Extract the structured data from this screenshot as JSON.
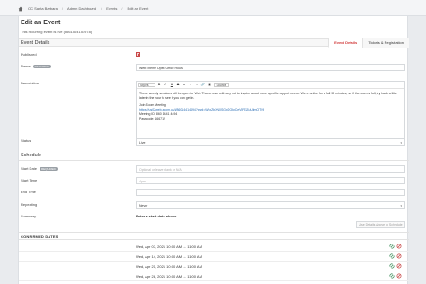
{
  "breadcrumb": {
    "items": [
      "OC Santa Barbara",
      "Admin Dashboard",
      "Events",
      "Edit an Event"
    ]
  },
  "page": {
    "title": "Edit an Event",
    "live_note": "This recurring event is live (#561504151978)"
  },
  "event_details": {
    "section_title": "Event Details",
    "tabs": [
      {
        "label": "Event Details",
        "active": true
      },
      {
        "label": "Tickets & Registration",
        "active": false
      }
    ],
    "published_label": "Published",
    "published_checked": true,
    "name_label": "Name",
    "name_badge": "REQUIRED",
    "name_value": "Web Theme Open Office Hours",
    "description_label": "Description",
    "toolbar": {
      "style_select": "Styles",
      "buttons": [
        "B",
        "I",
        "U",
        "S",
        "x",
        "≡",
        "≡",
        "🔗",
        "▣"
      ],
      "source_label": "Source"
    },
    "description_paragraphs": [
      "These weekly sessions will be open for Web Theme user with any not to inquire about more specific support needs. We're online for a full 90 minutes, so if the room is full, try back a little later in the hour to see if you can get in.",
      "Join Zoom Meeting"
    ],
    "zoom_link": "https://us02web.zoom.us/j/86014414494?pwd=WkxZbXN0SGw2QkxCeVlFZlZuUjlmQT09",
    "meeting_id": "Meeting ID: 860 1441 4494",
    "passcode": "Passcode: 166712",
    "status_label": "Status",
    "status_value": "Live"
  },
  "schedule": {
    "section_title": "Schedule",
    "start_date_label": "Start Date",
    "start_date_badge": "REQUIRED",
    "start_date_placeholder": "Optional or leave blank or N/A",
    "start_time_label": "Start Time",
    "start_time_placeholder": "4pm",
    "end_time_label": "End Time",
    "repeating_label": "Repeating",
    "repeating_value": "Never",
    "summary_label": "Summary",
    "summary_value": "Enter a start date above",
    "schedule_button": "Use Details Above to Schedule"
  },
  "confirmed_dates": {
    "title": "CONFIRMED DATES",
    "rows": [
      "Wed, Apr 07, 2021 10:00 AM → 11:00 AM",
      "Wed, Apr 14, 2021 10:00 AM → 11:00 AM",
      "Wed, Apr 21, 2021 10:00 AM → 11:00 AM",
      "Wed, Apr 28, 2021 10:00 AM → 11:00 AM"
    ]
  },
  "colors": {
    "accent": "#d13a3a",
    "link": "#2a6db4",
    "icon_green": "#3c8d5a",
    "icon_red": "#c94848"
  }
}
